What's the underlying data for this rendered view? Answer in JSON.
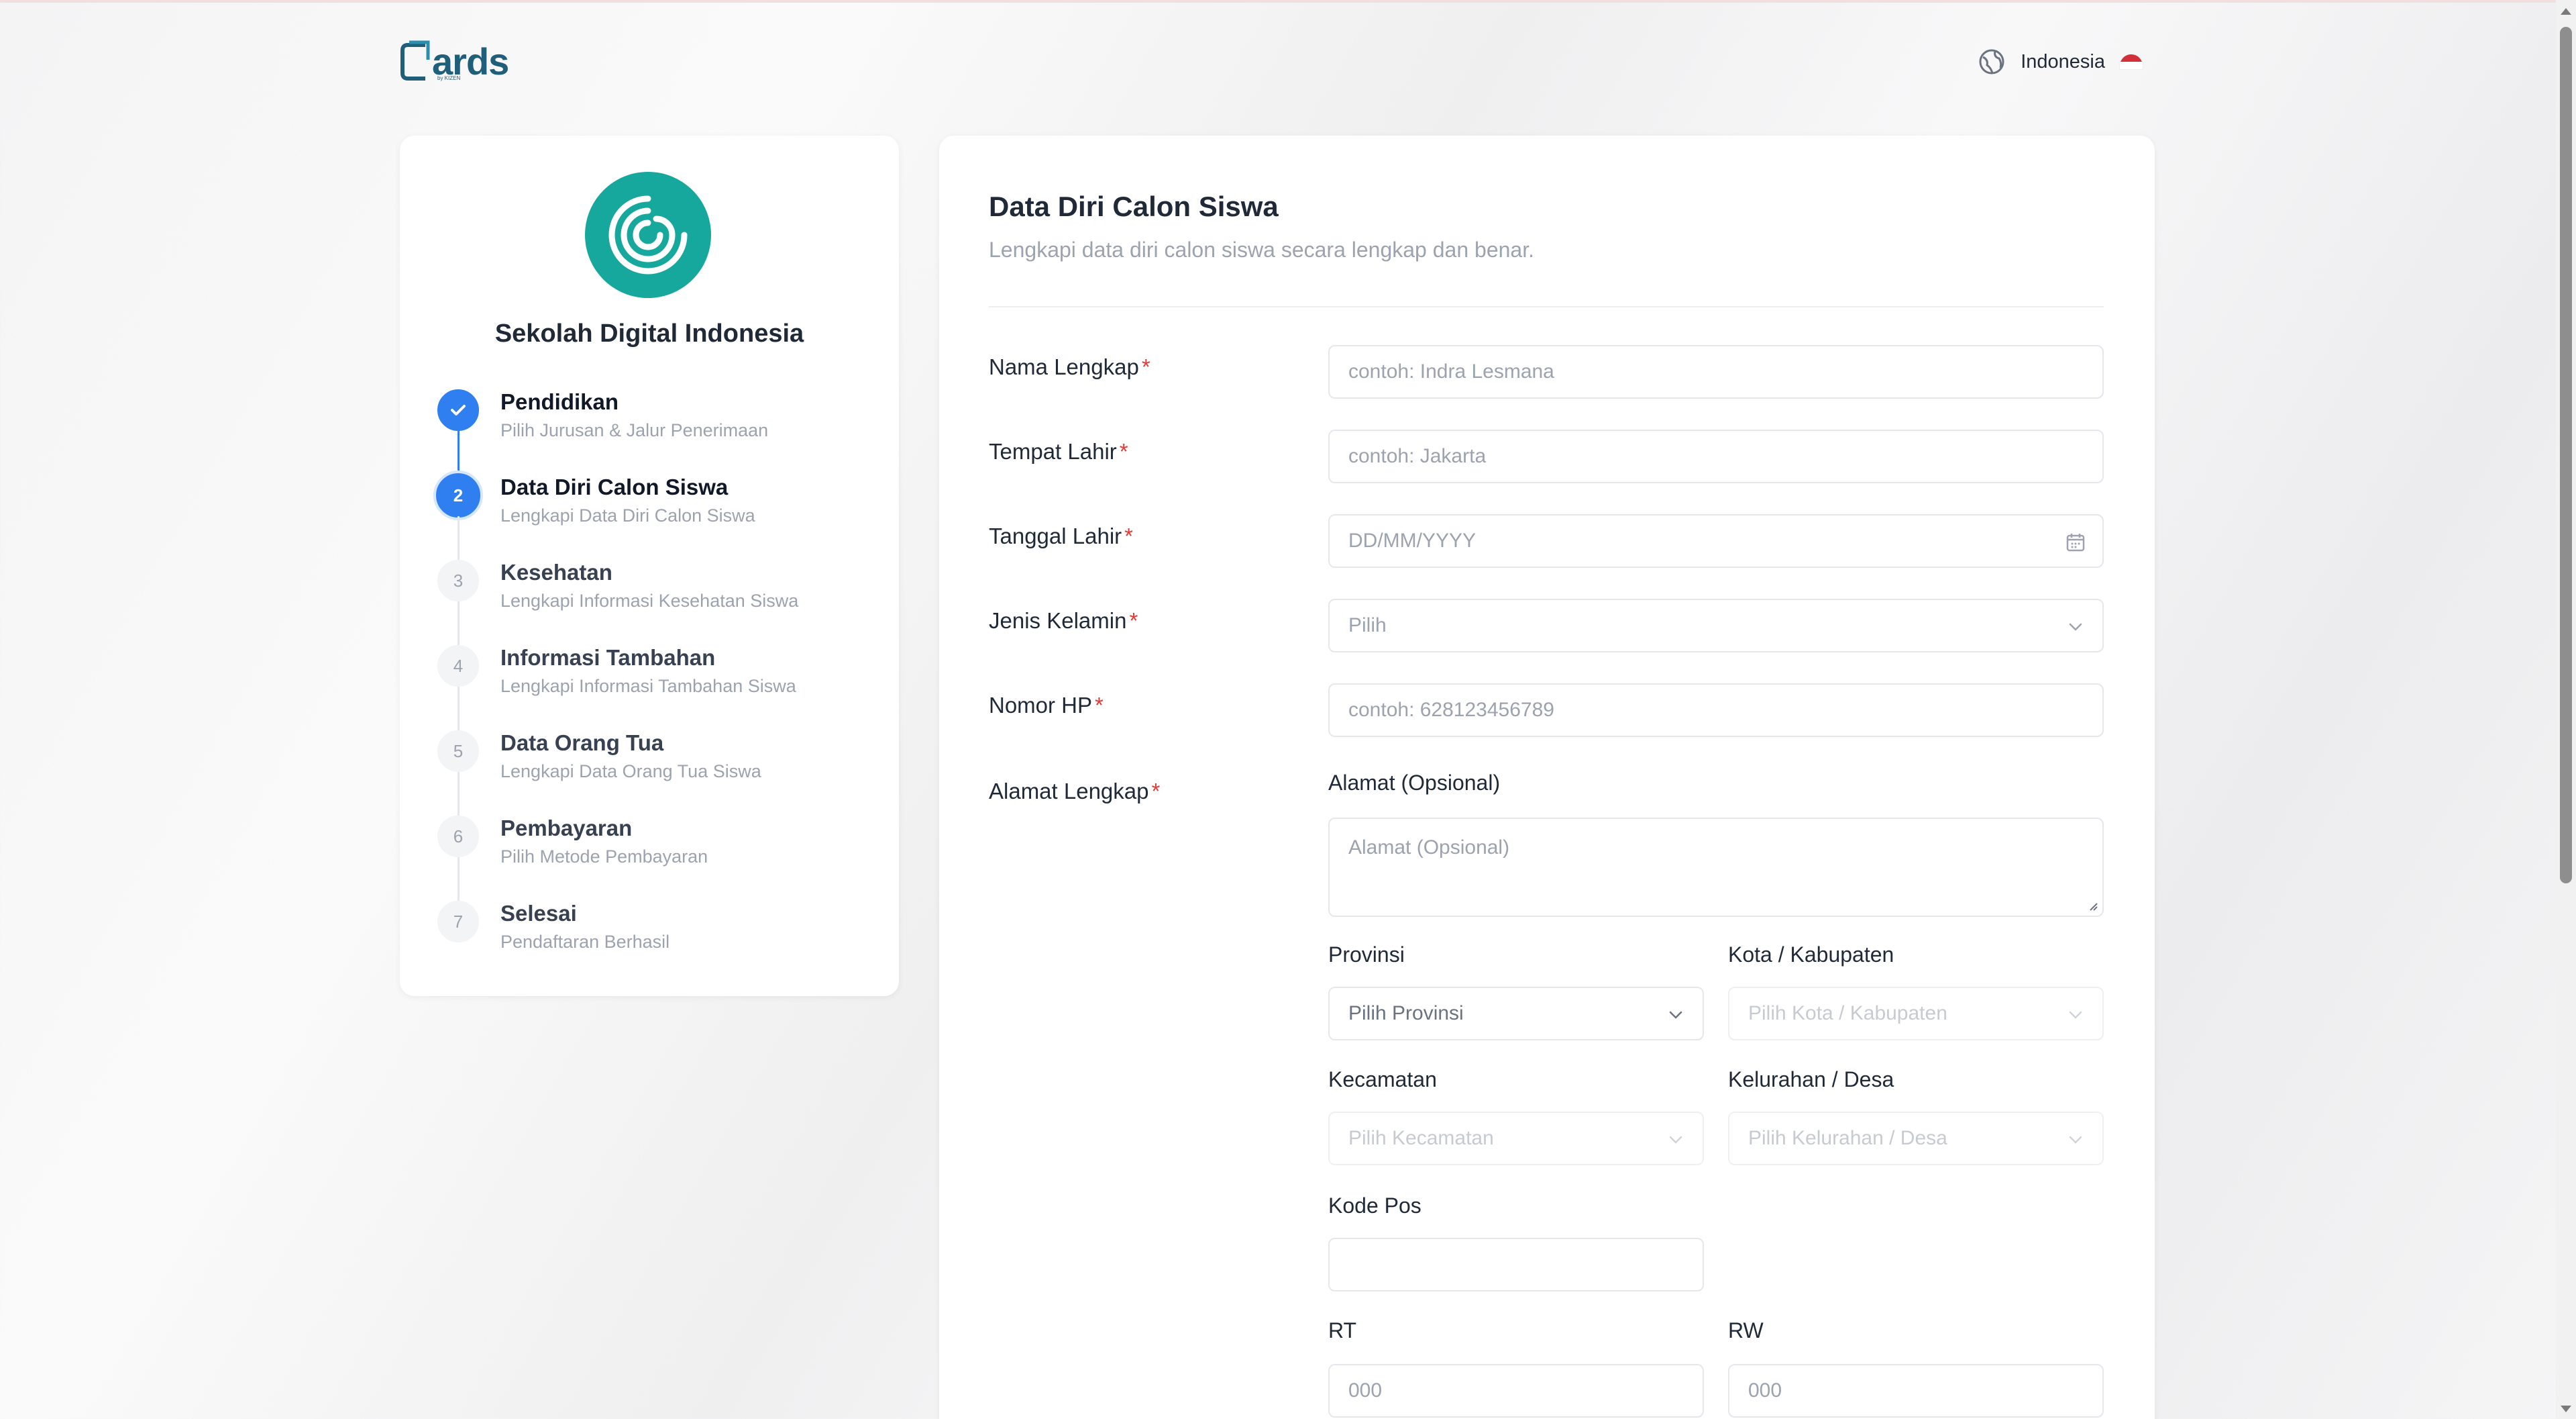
{
  "header": {
    "logo_text": "ards",
    "logo_sub": "by KIZEN",
    "language": "Indonesia"
  },
  "sidebar": {
    "school_name": "Sekolah Digital Indonesia",
    "steps": [
      {
        "number": "1",
        "title": "Pendidikan",
        "subtitle": "Pilih Jurusan & Jalur Penerimaan",
        "state": "done"
      },
      {
        "number": "2",
        "title": "Data Diri Calon Siswa",
        "subtitle": "Lengkapi Data Diri Calon Siswa",
        "state": "active"
      },
      {
        "number": "3",
        "title": "Kesehatan",
        "subtitle": "Lengkapi Informasi Kesehatan Siswa",
        "state": "pending"
      },
      {
        "number": "4",
        "title": "Informasi Tambahan",
        "subtitle": "Lengkapi Informasi Tambahan Siswa",
        "state": "pending"
      },
      {
        "number": "5",
        "title": "Data Orang Tua",
        "subtitle": "Lengkapi Data Orang Tua Siswa",
        "state": "pending"
      },
      {
        "number": "6",
        "title": "Pembayaran",
        "subtitle": "Pilih Metode Pembayaran",
        "state": "pending"
      },
      {
        "number": "7",
        "title": "Selesai",
        "subtitle": "Pendaftaran Berhasil",
        "state": "pending"
      }
    ]
  },
  "form": {
    "title": "Data Diri Calon Siswa",
    "subtitle": "Lengkapi data diri calon siswa secara lengkap dan benar.",
    "required_mark": "*",
    "fields": {
      "nama": {
        "label": "Nama Lengkap",
        "placeholder": "contoh: Indra Lesmana"
      },
      "tempat": {
        "label": "Tempat Lahir",
        "placeholder": "contoh: Jakarta"
      },
      "tanggal": {
        "label": "Tanggal Lahir",
        "placeholder": "DD/MM/YYYY"
      },
      "kelamin": {
        "label": "Jenis Kelamin",
        "placeholder": "Pilih"
      },
      "hp": {
        "label": "Nomor HP",
        "placeholder": "contoh: 628123456789"
      },
      "alamat_lengkap": {
        "label": "Alamat Lengkap"
      }
    },
    "address": {
      "alamat_label": "Alamat (Opsional)",
      "alamat_placeholder": "Alamat (Opsional)",
      "provinsi_label": "Provinsi",
      "provinsi_placeholder": "Pilih Provinsi",
      "kota_label": "Kota / Kabupaten",
      "kota_placeholder": "Pilih Kota / Kabupaten",
      "kecamatan_label": "Kecamatan",
      "kecamatan_placeholder": "Pilih Kecamatan",
      "kelurahan_label": "Kelurahan / Desa",
      "kelurahan_placeholder": "Pilih Kelurahan / Desa",
      "kodepos_label": "Kode Pos",
      "kodepos_value": "",
      "rt_label": "RT",
      "rt_placeholder": "000",
      "rw_label": "RW",
      "rw_placeholder": "000"
    }
  },
  "colors": {
    "primary": "#2f7ff0",
    "school_logo": "#17a89d",
    "brand": "#1f5f7a",
    "required": "#e53935"
  }
}
